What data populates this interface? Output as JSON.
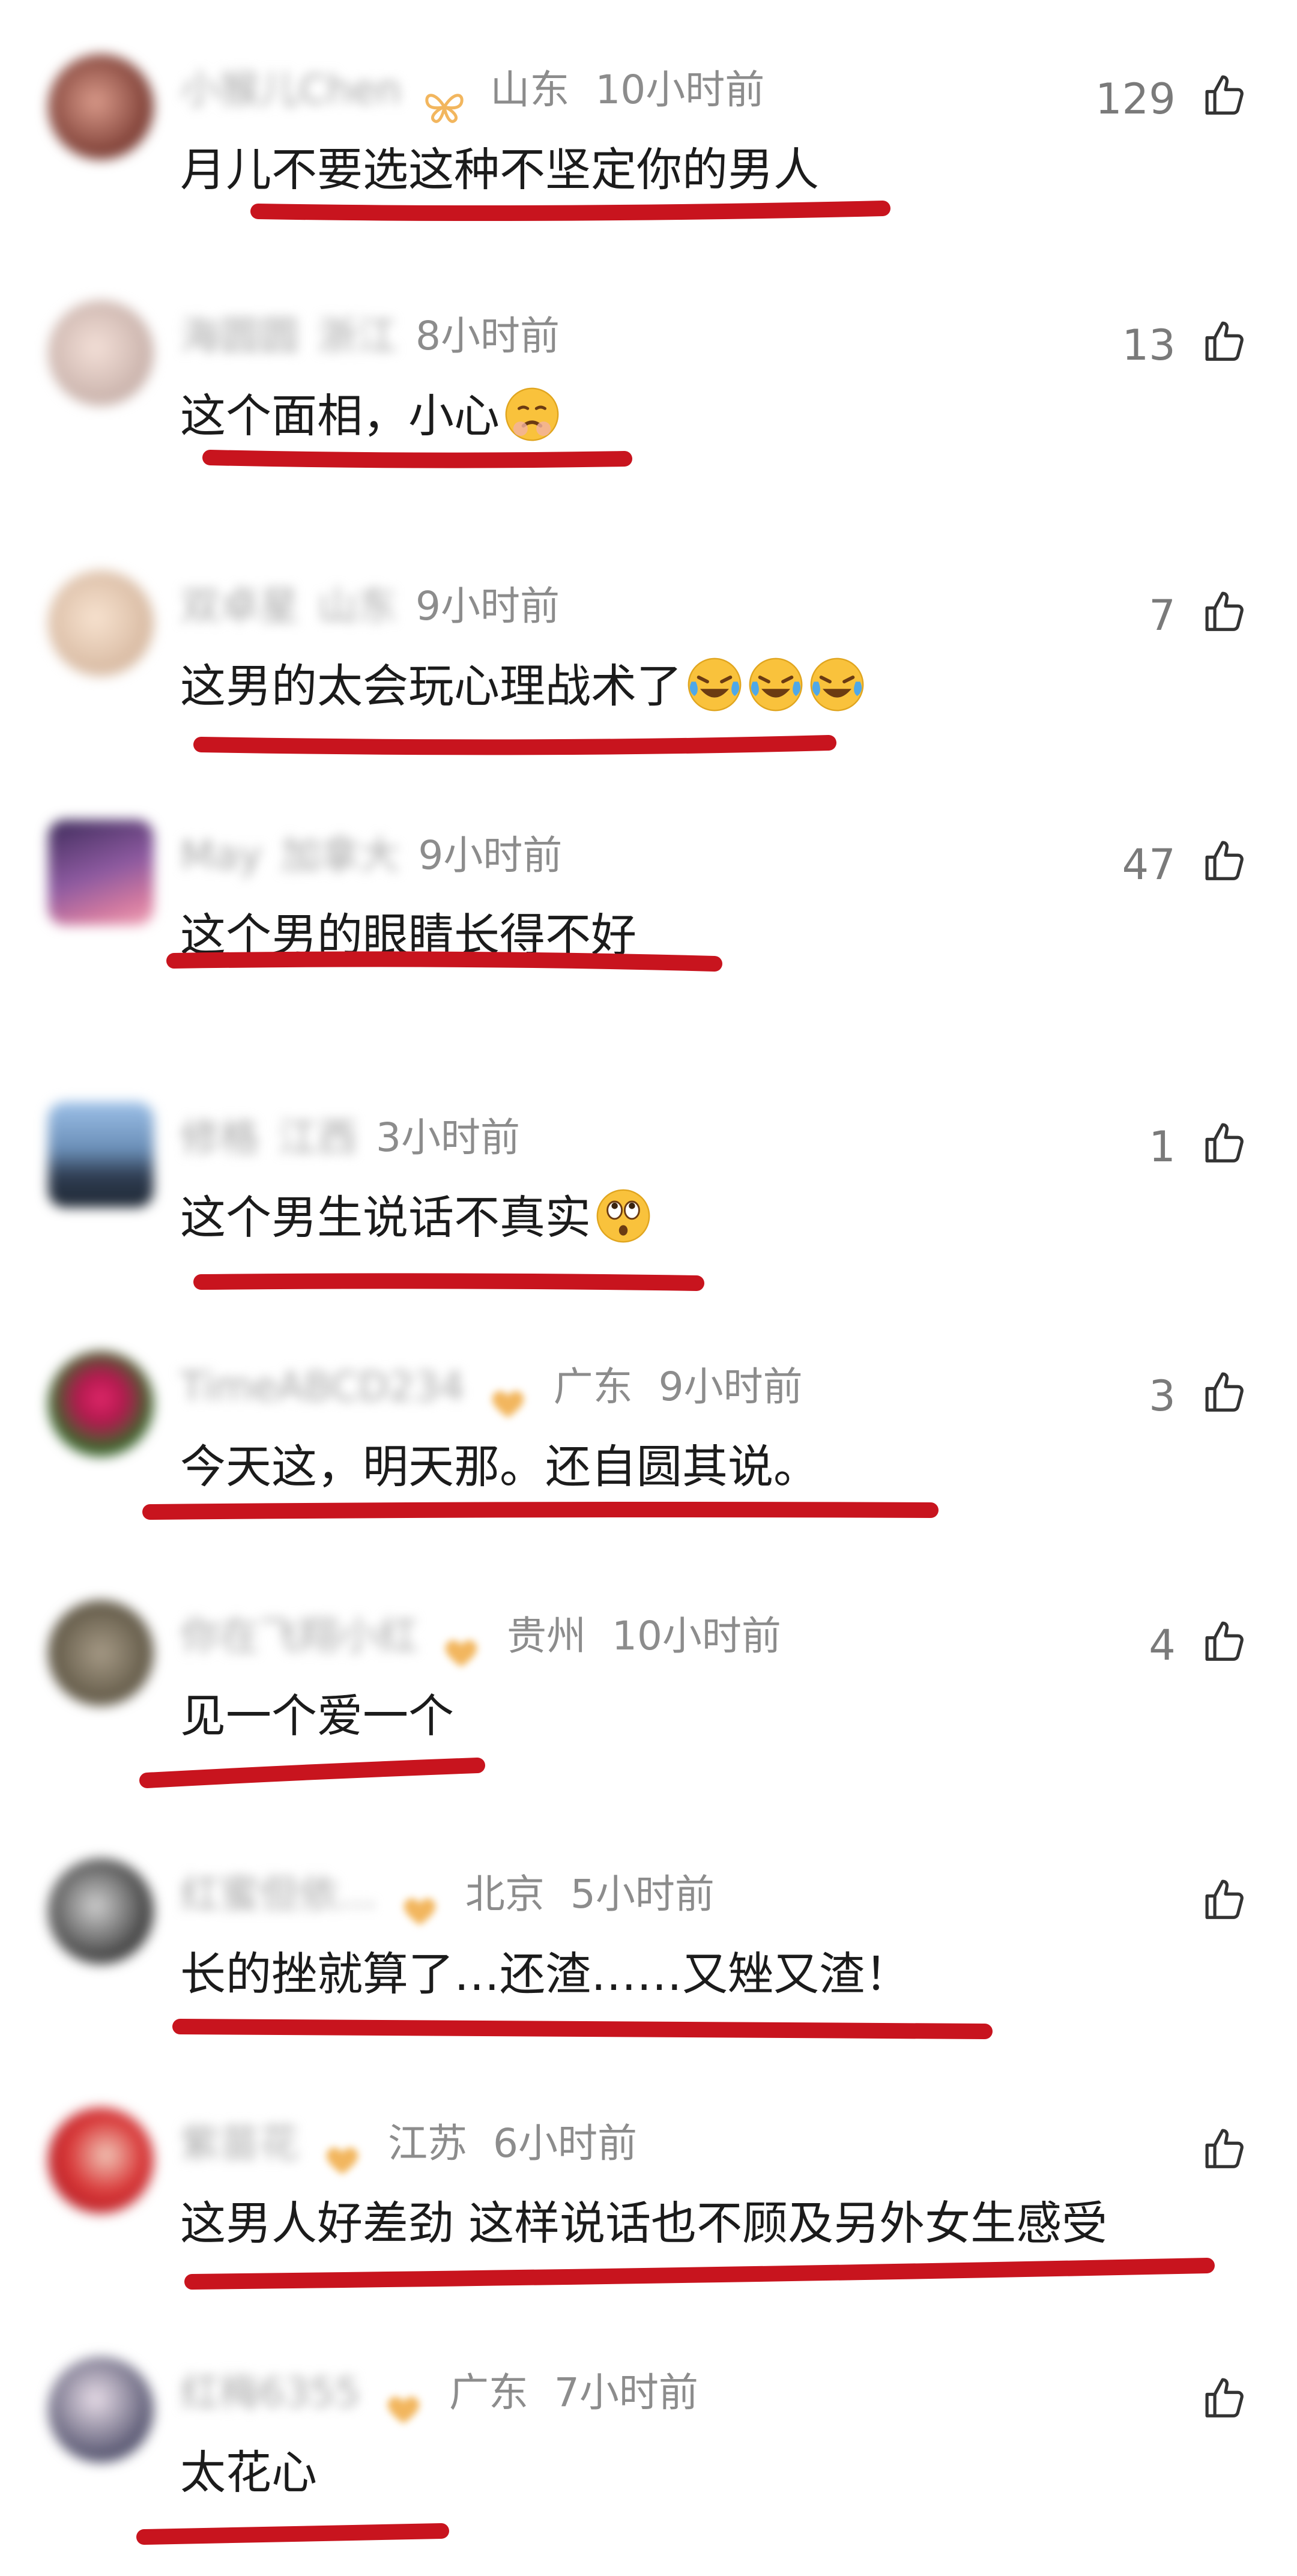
{
  "colors": {
    "underline": "#c8141e",
    "meta_text": "#8c8c8c",
    "comment_text": "#1b1b1b",
    "badge": "#f2b65e"
  },
  "comments": [
    {
      "user": "小猴儿Chen",
      "badge": "butterfly",
      "location": "山东",
      "time": "10小时前",
      "likes": "129",
      "text": "月儿不要选这种不坚定你的男人",
      "emojis": []
    },
    {
      "user": "海圆圆",
      "badge": "",
      "location": "浙江",
      "time": "8小时前",
      "likes": "13",
      "text": "这个面相，小心",
      "emojis": [
        "worried-face-icon"
      ]
    },
    {
      "user": "双卓星",
      "badge": "",
      "location": "山东",
      "time": "9小时前",
      "likes": "7",
      "text": "这男的太会玩心理战术了",
      "emojis": [
        "laugh-cry-icon",
        "laugh-cry-icon",
        "laugh-cry-icon"
      ]
    },
    {
      "user": "May",
      "badge": "",
      "location": "加拿大",
      "time": "9小时前",
      "likes": "47",
      "text": "这个男的眼睛长得不好",
      "emojis": []
    },
    {
      "user": "修格",
      "badge": "",
      "location": "江西",
      "time": "3小时前",
      "likes": "1",
      "text": "这个男生说话不真实",
      "emojis": [
        "eye-roll-icon"
      ]
    },
    {
      "user": "TimeABCD234",
      "badge": "heart",
      "location": "广东",
      "time": "9小时前",
      "likes": "3",
      "text": "今天这，明天那。还自圆其说。",
      "emojis": []
    },
    {
      "user": "你在飞翔小红",
      "badge": "heart",
      "location": "贵州",
      "time": "10小时前",
      "likes": "4",
      "text": "见一个爱一个",
      "emojis": []
    },
    {
      "user": "红蜜但依...",
      "badge": "heart",
      "location": "北京",
      "time": "5小时前",
      "likes": "",
      "text": "长的挫就算了…还渣……又矬又渣！",
      "emojis": []
    },
    {
      "user": "紫苗花",
      "badge": "heart",
      "location": "江苏",
      "time": "6小时前",
      "likes": "",
      "text": "这男人好差劲 这样说话也不顾及另外女生感受",
      "emojis": []
    },
    {
      "user": "红梅6355",
      "badge": "heart",
      "location": "广东",
      "time": "7小时前",
      "likes": "",
      "text": "太花心",
      "emojis": []
    }
  ]
}
